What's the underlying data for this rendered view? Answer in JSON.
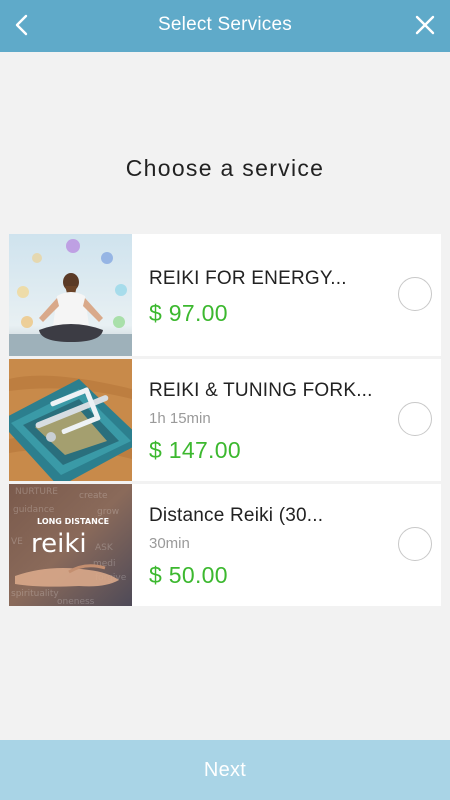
{
  "header": {
    "title": "Select Services",
    "back_icon": "chevron-left-icon",
    "close_icon": "close-icon",
    "background": "#5faac9"
  },
  "main": {
    "heading": "Choose a service"
  },
  "services": [
    {
      "name": "REIKI FOR ENERGY...",
      "duration": "",
      "price": "$ 97.00",
      "image": "meditation-image",
      "selected": false
    },
    {
      "name": "REIKI & TUNING FORK...",
      "duration": "1h 15min",
      "price": "$ 147.00",
      "image": "tuning-fork-image",
      "selected": false
    },
    {
      "name": "Distance Reiki (30...",
      "duration": "30min",
      "price": "$ 50.00",
      "image": "long-distance-reiki-image",
      "image_text": "LONG DISTANCE reiki",
      "selected": false
    }
  ],
  "footer": {
    "next_label": "Next",
    "background": "#a9d4e6"
  },
  "colors": {
    "price": "#3cb82f",
    "page_background": "#f2f2f2"
  }
}
